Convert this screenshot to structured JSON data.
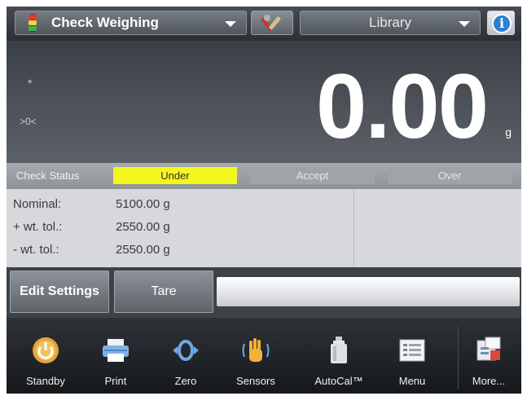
{
  "topbar": {
    "app_name": "Check Weighing",
    "library_label": "Library",
    "info_symbol": "i",
    "icons": {
      "app": "traffic-light-icon",
      "tool": "tools-icon",
      "info": "info-icon"
    }
  },
  "display": {
    "stable_mark": "*",
    "net_indicator": ">0<",
    "weight": "0.00",
    "unit": "g"
  },
  "check_status": {
    "title": "Check Status",
    "segments": [
      "Under",
      "Accept",
      "Over"
    ],
    "active": "Under",
    "active_color": "#f5f51f"
  },
  "params": [
    {
      "label": "Nominal:",
      "value": "5100.00 g"
    },
    {
      "label": "+ wt. tol.:",
      "value": "2550.00 g"
    },
    {
      "label": "- wt. tol.:",
      "value": "2550.00 g"
    }
  ],
  "actions": {
    "edit": "Edit Settings",
    "tare": "Tare"
  },
  "toolbar": [
    {
      "label": "Standby",
      "icon": "power-icon"
    },
    {
      "label": "Print",
      "icon": "printer-icon"
    },
    {
      "label": "Zero",
      "icon": "zero-icon"
    },
    {
      "label": "Sensors",
      "icon": "hand-sensor-icon"
    },
    {
      "label": "AutoCal™",
      "icon": "autocal-weight-icon"
    },
    {
      "label": "Menu",
      "icon": "menu-list-icon"
    },
    {
      "label": "More...",
      "icon": "more-apps-icon"
    }
  ]
}
